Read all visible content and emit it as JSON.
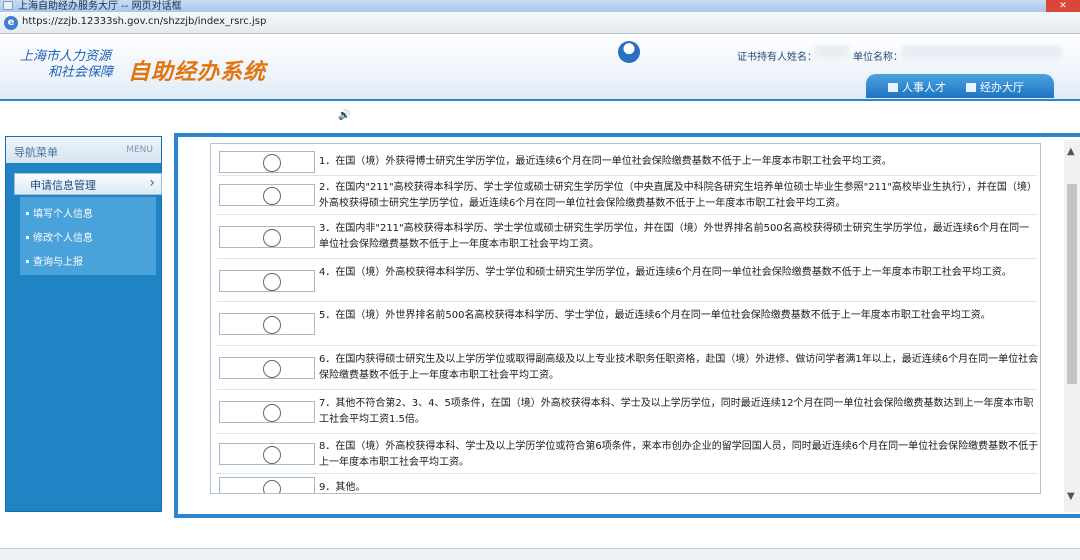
{
  "browser": {
    "title": "上海自助经办服务大厅 -- 网页对话框",
    "url": "https://zzjb.12333sh.gov.cn/shzzjb/index_rsrc.jsp"
  },
  "header": {
    "org_line1": "上海市人力资源",
    "org_line2": "和社会保障",
    "system_name": "自助经办系统",
    "holder_label": "证书持有人姓名：",
    "unit_label": "单位名称：",
    "nav_talent": "人事人才",
    "nav_hall": "经办大厅"
  },
  "sidebar": {
    "title": "导航菜单",
    "title_en": "MENU",
    "section": "申请信息管理",
    "items": [
      "填写个人信息",
      "修改个人信息",
      "查询与上报"
    ]
  },
  "options": [
    {
      "text": "1．在国（境）外获得博士研究生学历学位，最近连续6个月在同一单位社会保险缴费基数不低于上一年度本市职工社会平均工资。"
    },
    {
      "text": "2．在国内\"211\"高校获得本科学历、学士学位或硕士研究生学历学位（中央直属及中科院各研究生培养单位硕士毕业生参照\"211\"高校毕业生执行），并在国（境）外高校获得硕士研究生学历学位，最近连续6个月在同一单位社会保险缴费基数不低于上一年度本市职工社会平均工资。"
    },
    {
      "text": "3．在国内非\"211\"高校获得本科学历、学士学位或硕士研究生学历学位，并在国（境）外世界排名前500名高校获得硕士研究生学历学位，最近连续6个月在同一单位社会保险缴费基数不低于上一年度本市职工社会平均工资。"
    },
    {
      "text": "4．在国（境）外高校获得本科学历、学士学位和硕士研究生学历学位，最近连续6个月在同一单位社会保险缴费基数不低于上一年度本市职工社会平均工资。"
    },
    {
      "text": "5．在国（境）外世界排名前500名高校获得本科学历、学士学位，最近连续6个月在同一单位社会保险缴费基数不低于上一年度本市职工社会平均工资。"
    },
    {
      "text": "6．在国内获得硕士研究生及以上学历学位或取得副高级及以上专业技术职务任职资格，赴国（境）外进修、做访问学者满1年以上，最近连续6个月在同一单位社会保险缴费基数不低于上一年度本市职工社会平均工资。"
    },
    {
      "text": "7．其他不符合第2、3、4、5项条件，在国（境）外高校获得本科、学士及以上学历学位，同时最近连续12个月在同一单位社会保险缴费基数达到上一年度本市职工社会平均工资1.5倍。"
    },
    {
      "text": "8．在国（境）外高校获得本科、学士及以上学历学位或符合第6项条件，来本市创办企业的留学回国人员，同时最近连续6个月在同一单位社会保险缴费基数不低于上一年度本市职工社会平均工资。"
    },
    {
      "text": "9．其他。"
    }
  ]
}
